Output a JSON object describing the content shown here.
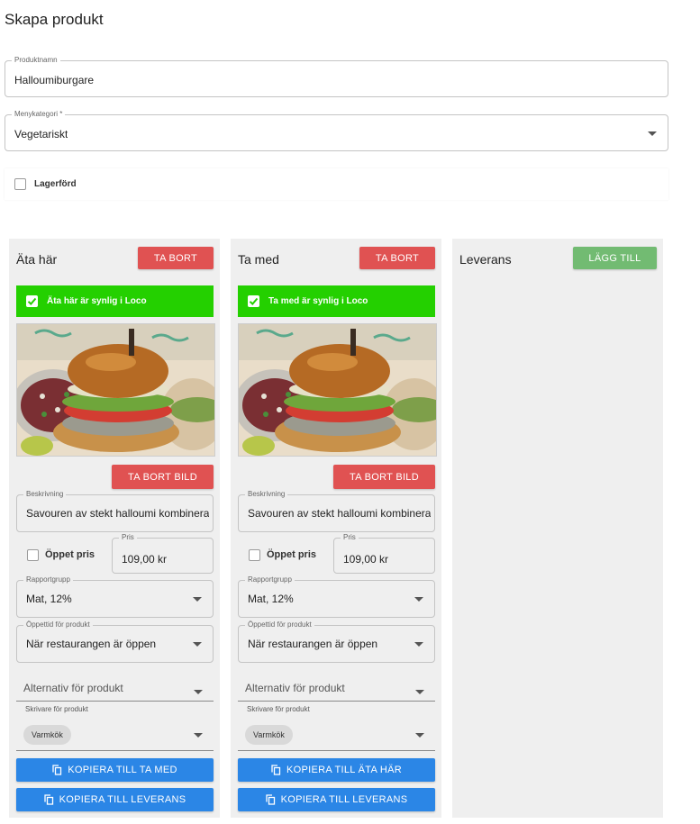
{
  "page": {
    "title": "Skapa produkt"
  },
  "form": {
    "product_name_label": "Produktnamn",
    "product_name_value": "Halloumiburgare",
    "category_label": "Menykategori *",
    "category_value": "Vegetariskt",
    "stocked_label": "Lagerförd"
  },
  "columns": [
    {
      "title": "Äta här",
      "remove_label": "TA BORT",
      "visible_label": "Äta här är synlig i Loco",
      "remove_image_label": "TA BORT BILD",
      "description_label": "Beskrivning",
      "description_value": "Savouren av stekt halloumi kombinerat",
      "open_price_label": "Öppet pris",
      "price_label": "Pris",
      "price_value": "109,00 kr",
      "report_group_label": "Rapportgrupp",
      "report_group_value": "Mat, 12%",
      "open_time_label": "Öppettid för produkt",
      "open_time_value": "När restaurangen är öppen",
      "options_placeholder": "Alternativ för produkt",
      "printer_label": "Skrivare för produkt",
      "printer_chip": "Varmkök",
      "copy_button_1": "KOPIERA TILL TA MED",
      "copy_button_2": "KOPIERA TILL LEVERANS"
    },
    {
      "title": "Ta med",
      "remove_label": "TA BORT",
      "visible_label": "Ta med är synlig i Loco",
      "remove_image_label": "TA BORT BILD",
      "description_label": "Beskrivning",
      "description_value": "Savouren av stekt halloumi kombinerat",
      "open_price_label": "Öppet pris",
      "price_label": "Pris",
      "price_value": "109,00 kr",
      "report_group_label": "Rapportgrupp",
      "report_group_value": "Mat, 12%",
      "open_time_label": "Öppettid för produkt",
      "open_time_value": "När restaurangen är öppen",
      "options_placeholder": "Alternativ för produkt",
      "printer_label": "Skrivare för produkt",
      "printer_chip": "Varmkök",
      "copy_button_1": "KOPIERA TILL ÄTA HÄR",
      "copy_button_2": "KOPIERA TILL LEVERANS"
    },
    {
      "title": "Leverans",
      "add_label": "LÄGG TILL"
    }
  ],
  "colors": {
    "danger": "#e05252",
    "success": "#72bb72",
    "visible_bar": "#24d000",
    "primary": "#2b86e6",
    "column_bg": "#efefef"
  },
  "icons": [
    "checkbox-empty-icon",
    "checkbox-checked-icon",
    "dropdown-caret-icon",
    "copy-icon"
  ]
}
